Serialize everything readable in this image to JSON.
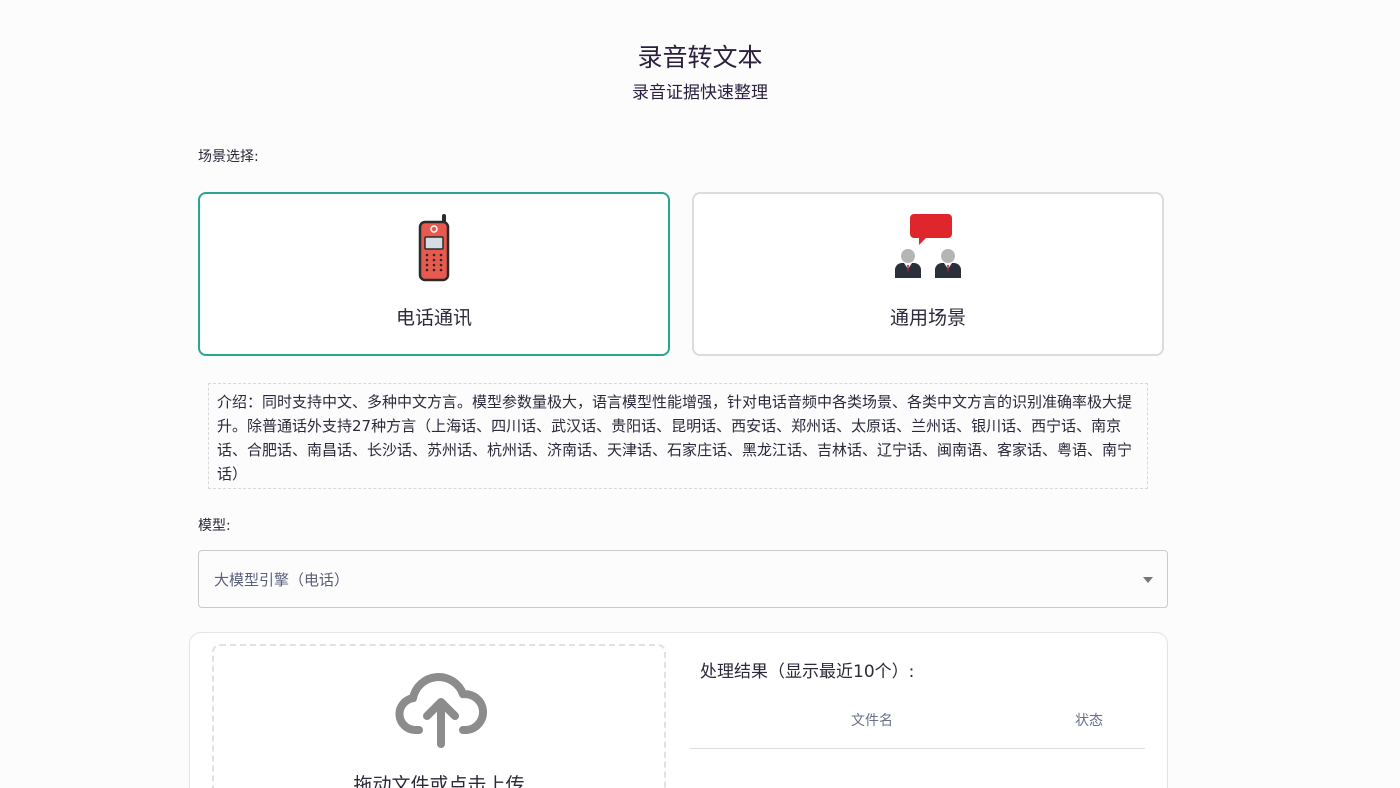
{
  "header": {
    "title": "录音转文本",
    "subtitle": "录音证据快速整理"
  },
  "scene": {
    "label": "场景选择:",
    "cards": [
      {
        "label": "电话通讯",
        "icon": "mobile-phone-icon",
        "selected": true
      },
      {
        "label": "通用场景",
        "icon": "conversation-people-icon",
        "selected": false
      }
    ]
  },
  "intro": {
    "text": "介绍：同时支持中文、多种中文方言。模型参数量极大，语言模型性能增强，针对电话音频中各类场景、各类中文方言的识别准确率极大提升。除普通话外支持27种方言（上海话、四川话、武汉话、贵阳话、昆明话、西安话、郑州话、太原话、兰州话、银川话、西宁话、南京话、合肥话、南昌话、长沙话、苏州话、杭州话、济南话、天津话、石家庄话、黑龙江话、吉林话、辽宁话、闽南语、客家话、粤语、南宁话）"
  },
  "model": {
    "label": "模型:",
    "selected": "大模型引擎（电话）"
  },
  "upload": {
    "icon": "cloud-upload-icon",
    "text": "拖动文件或点击上传"
  },
  "results": {
    "title": "处理结果（显示最近10个）:",
    "columns": [
      "文件名",
      "状态"
    ]
  },
  "colors": {
    "accent": "#2aa58f",
    "border": "#dcdcdf"
  }
}
